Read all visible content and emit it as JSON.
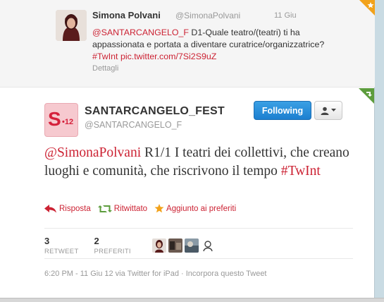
{
  "context_tweet": {
    "author_name": "Simona Polvani",
    "author_handle": "@SimonaPolvani",
    "time": "11 Giu",
    "mention": "@SANTARCANGELO_F",
    "text_part1": " D1-Quale teatro/(teatri) ti ha appassionata e portata a diventare curatrice/organizzatrice? ",
    "hashtag": "#TwInt",
    "link": "pic.twitter.com/7Si2S9uZ",
    "details_label": "Dettagli",
    "avatar_icon": "user-photo-icon"
  },
  "tweet": {
    "author_name": "SANTARCANGELO_FEST",
    "author_handle": "@SANTARCANGELO_F",
    "avatar_logo_letter": "S",
    "avatar_logo_number": "•12",
    "mention": "@SimonaPolvani",
    "text": " R1/1 I teatri dei collettivi, che creano luoghi e comunità, che riscrivono il tempo ",
    "hashtag": "#TwInt",
    "following_label": "Following",
    "actions": {
      "reply": "Risposta",
      "retweet": "Ritwittato",
      "favorite": "Aggiunto ai preferiti"
    },
    "stats": {
      "retweets_count": "3",
      "retweets_label": "RETWEET",
      "favorites_count": "2",
      "favorites_label": "PREFERITI"
    },
    "meta": "6:20 PM - 11 Giu 12 via Twitter for iPad · Incorpora questo Tweet"
  },
  "colors": {
    "link": "#cc2233",
    "follow_button": "#2b8fdc",
    "retweet_green": "#5c9c3c",
    "favorite_orange": "#f2a21a"
  }
}
